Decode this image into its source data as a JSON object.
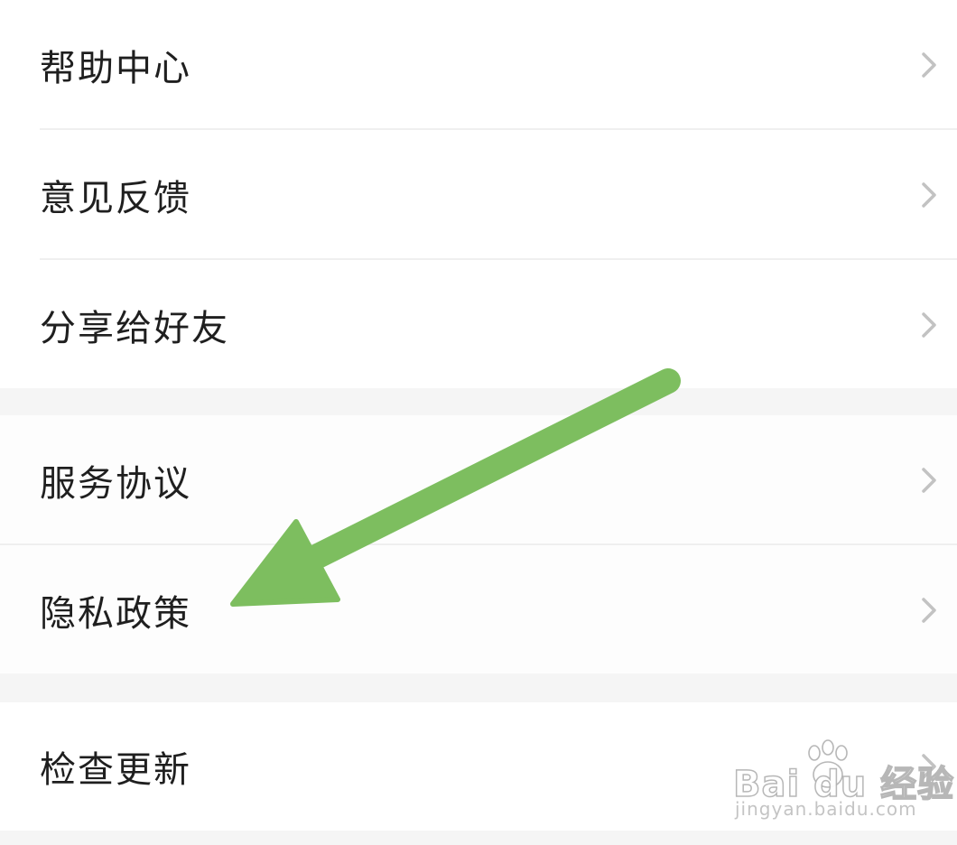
{
  "menu": {
    "group1": [
      {
        "label": "帮助中心"
      },
      {
        "label": "意见反馈"
      },
      {
        "label": "分享给好友"
      }
    ],
    "group2": [
      {
        "label": "服务协议"
      },
      {
        "label": "隐私政策"
      }
    ],
    "group3": [
      {
        "label": "检查更新"
      }
    ]
  },
  "icons": {
    "row_chevron": "chevron-right-icon"
  },
  "annotation": {
    "arrow_color": "#7dbe5f",
    "target": "隐私政策"
  },
  "watermark": {
    "brand_main": "Bai du 经验",
    "brand_sub": "jingyan.baidu.com"
  },
  "colors": {
    "background": "#f5f5f5",
    "row_background": "#ffffff",
    "text": "#1f1f1f",
    "chevron": "#c2c2c2"
  }
}
